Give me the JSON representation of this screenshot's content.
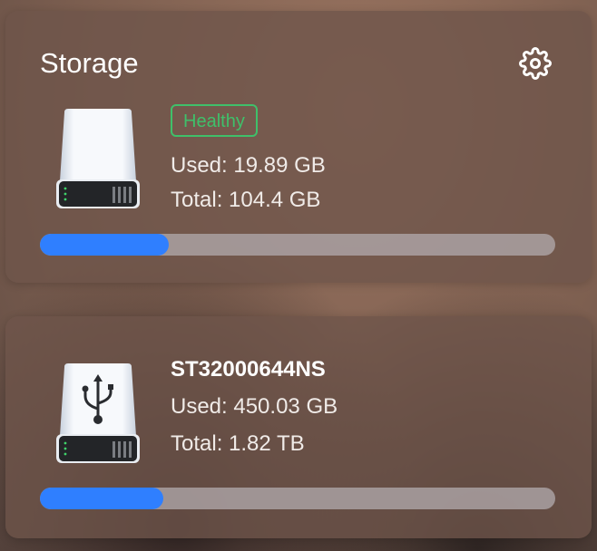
{
  "storage": {
    "title": "Storage",
    "settings_icon": "gear-icon",
    "drives": [
      {
        "icon": "hard-drive-icon",
        "badge": "Healthy",
        "used": "Used: 19.89 GB",
        "total": "Total: 104.4 GB",
        "usage_fraction": 0.25
      },
      {
        "icon": "usb-drive-icon",
        "name": "ST32000644NS",
        "used": "Used: 450.03 GB",
        "total": "Total: 1.82 TB",
        "usage_fraction": 0.24
      }
    ]
  },
  "colors": {
    "healthy": "#3fc06a",
    "progress": "#2f7fff"
  }
}
